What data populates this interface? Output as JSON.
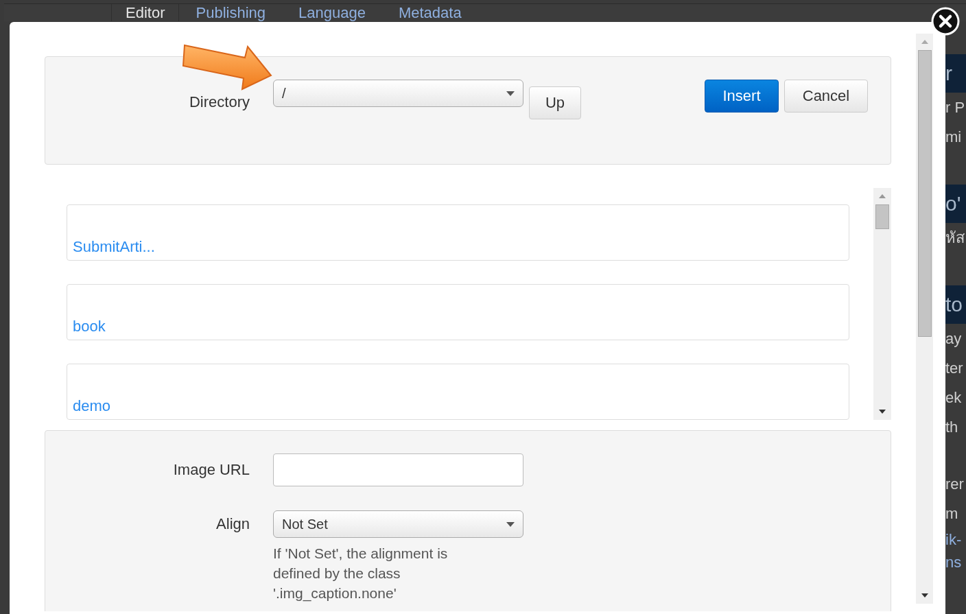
{
  "background": {
    "tabs": [
      {
        "label": "Editor",
        "selected": true
      },
      {
        "label": "Publishing",
        "selected": false
      },
      {
        "label": "Language",
        "selected": false
      },
      {
        "label": "Metadata",
        "selected": false
      }
    ],
    "side_fragments": [
      {
        "kind": "gap"
      },
      {
        "kind": "heading",
        "text": "r"
      },
      {
        "kind": "text",
        "text": "r P"
      },
      {
        "kind": "text",
        "text": "mi"
      },
      {
        "kind": "gap"
      },
      {
        "kind": "heading",
        "text": "o'"
      },
      {
        "kind": "text",
        "text": "หัส"
      },
      {
        "kind": "gap"
      },
      {
        "kind": "heading",
        "text": "to"
      },
      {
        "kind": "text",
        "text": "ay"
      },
      {
        "kind": "text",
        "text": "ter"
      },
      {
        "kind": "text",
        "text": "ek"
      },
      {
        "kind": "text",
        "text": "th"
      },
      {
        "kind": "gap"
      },
      {
        "kind": "text",
        "text": "rer"
      },
      {
        "kind": "text",
        "text": "m"
      },
      {
        "kind": "link",
        "text": "ik-"
      },
      {
        "kind": "link",
        "text": "ns"
      }
    ]
  },
  "dialog": {
    "directory": {
      "label": "Directory",
      "value": "/",
      "up": "Up"
    },
    "buttons": [
      {
        "label": "Insert",
        "kind": "primary"
      },
      {
        "label": "Cancel",
        "kind": "default"
      }
    ],
    "folders": [
      "SubmitArti...",
      "book",
      "demo"
    ],
    "image_url": {
      "label": "Image URL"
    },
    "align": {
      "label": "Align",
      "value": "Not Set",
      "help": "If 'Not Set', the alignment is defined by the class '.img_caption.none'"
    }
  }
}
